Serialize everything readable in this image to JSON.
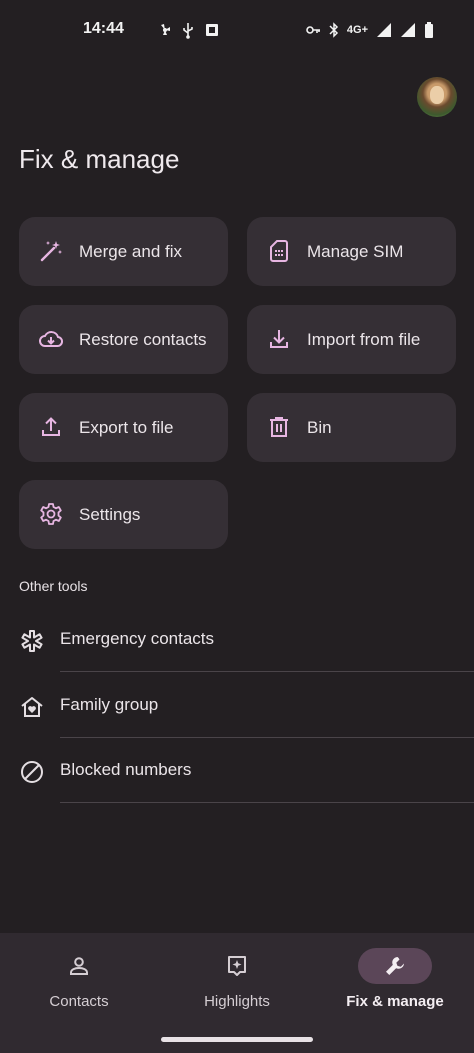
{
  "status_bar": {
    "time": "14:44",
    "network": "4G+",
    "left_icons": [
      "fan-icon",
      "usb-icon",
      "app-icon"
    ],
    "right_icons": [
      "vpn-key-icon",
      "bluetooth-icon",
      "signal-icon",
      "signal-icon",
      "battery-icon"
    ]
  },
  "header": {
    "title": "Fix & manage"
  },
  "cards": [
    {
      "label": "Merge and fix",
      "icon": "magic-wand-icon"
    },
    {
      "label": "Manage SIM",
      "icon": "sim-card-icon"
    },
    {
      "label": "Restore contacts",
      "icon": "cloud-download-icon"
    },
    {
      "label": "Import from file",
      "icon": "download-icon"
    },
    {
      "label": "Export to file",
      "icon": "upload-icon"
    },
    {
      "label": "Bin",
      "icon": "trash-icon"
    },
    {
      "label": "Settings",
      "icon": "gear-icon"
    }
  ],
  "other_tools": {
    "section_label": "Other tools",
    "items": [
      {
        "label": "Emergency contacts",
        "icon": "asterisk-icon"
      },
      {
        "label": "Family group",
        "icon": "house-heart-icon"
      },
      {
        "label": "Blocked numbers",
        "icon": "blocked-icon"
      }
    ]
  },
  "bottom_nav": {
    "items": [
      {
        "label": "Contacts",
        "icon": "person-icon",
        "active": false
      },
      {
        "label": "Highlights",
        "icon": "highlights-icon",
        "active": false
      },
      {
        "label": "Fix & manage",
        "icon": "wrench-icon",
        "active": true
      }
    ]
  },
  "colors": {
    "background": "#231f22",
    "card": "#352f35",
    "accent_icon": "#e7b6e2",
    "nav_active_pill": "#5b4658"
  }
}
